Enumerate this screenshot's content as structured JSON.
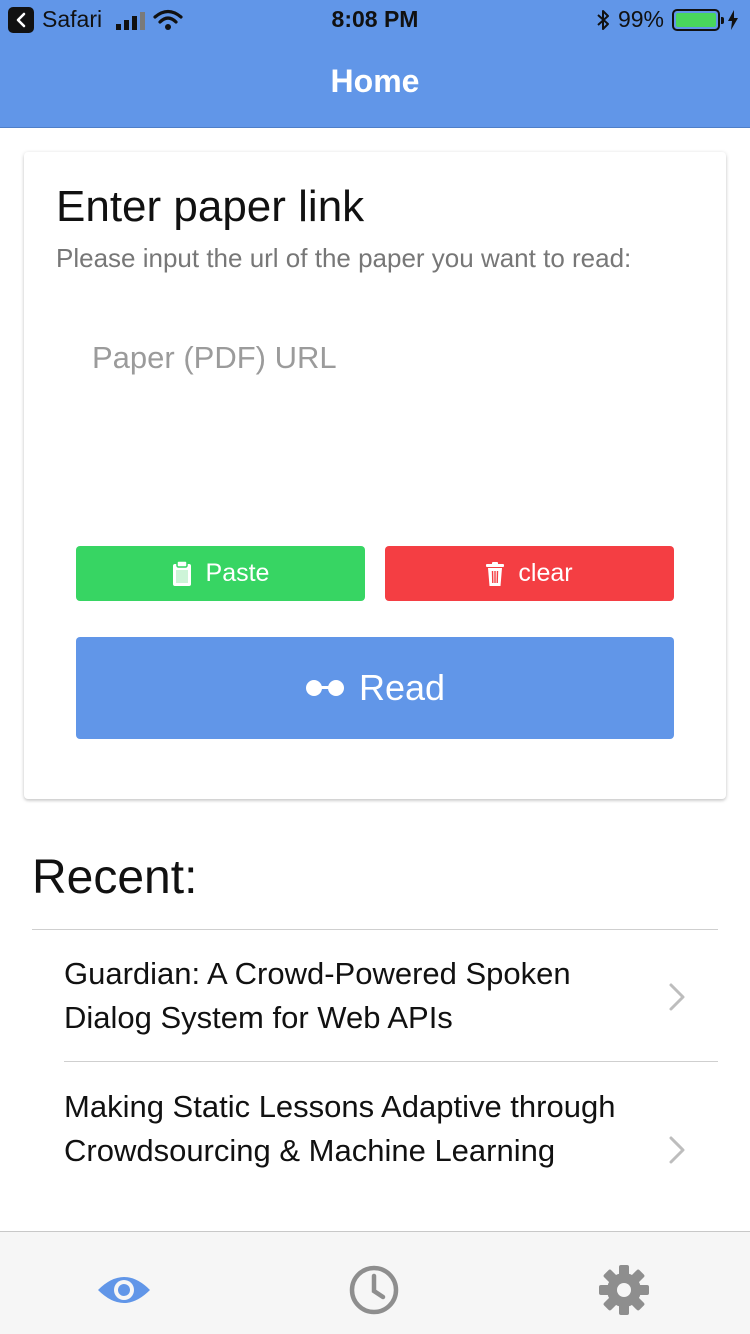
{
  "status_bar": {
    "back_app": "Safari",
    "time": "8:08 PM",
    "battery_percent": "99%",
    "battery_level": 0.99
  },
  "nav": {
    "title": "Home"
  },
  "card": {
    "title": "Enter paper link",
    "subtitle": "Please input the url of the paper you want to read:",
    "url_input": {
      "value": "",
      "placeholder": "Paper (PDF) URL"
    },
    "paste_label": "Paste",
    "clear_label": "clear",
    "read_label": "Read"
  },
  "recent": {
    "title": "Recent:",
    "items": [
      {
        "label": "Guardian: A Crowd-Powered Spoken Dialog System for Web APIs"
      },
      {
        "label": "Making Static Lessons Adaptive through Crowdsourcing & Machine Learning"
      }
    ]
  },
  "tabs": [
    {
      "name": "home",
      "icon": "eye-icon",
      "active": true
    },
    {
      "name": "history",
      "icon": "clock-icon",
      "active": false
    },
    {
      "name": "settings",
      "icon": "gear-icon",
      "active": false
    }
  ],
  "colors": {
    "primary": "#6196e8",
    "paste": "#37d563",
    "clear": "#f43e43",
    "tab_active": "#6196e8",
    "tab_inactive": "#8e8e8e"
  }
}
